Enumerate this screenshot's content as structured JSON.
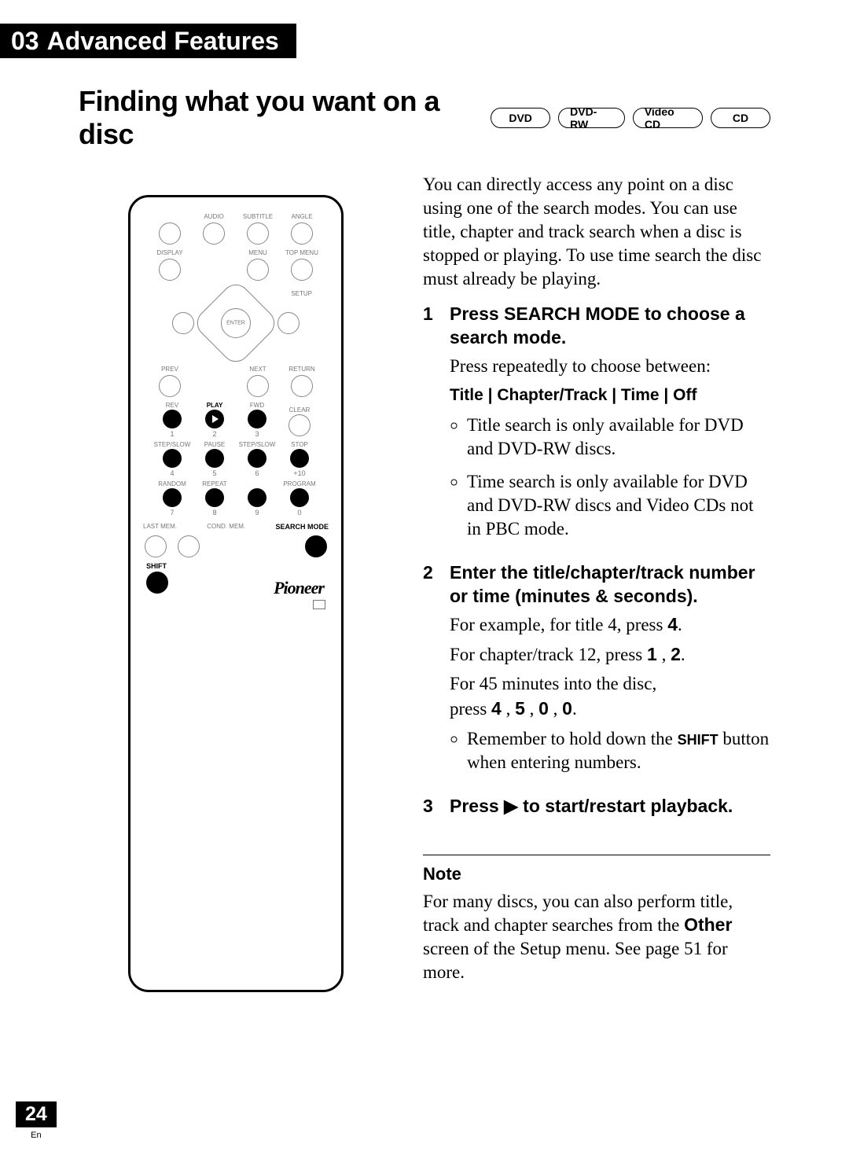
{
  "header": {
    "chapter_num": "03",
    "chapter_title": "Advanced Features"
  },
  "section": {
    "title": "Finding what you want on a disc",
    "media": [
      "DVD",
      "DVD-RW",
      "Video CD",
      "CD"
    ]
  },
  "intro": "You can directly access any point on a disc using one of the search modes. You can use title, chapter and track search when a disc is stopped or playing. To use time search the disc must already be playing.",
  "steps": {
    "s1": {
      "num": "1",
      "head": "Press SEARCH MODE to choose a search mode.",
      "sub": "Press repeatedly to choose between:",
      "modes": "Title | Chapter/Track | Time | Off",
      "b1": "Title search is only available for DVD and DVD-RW discs.",
      "b2": "Time search is only available for DVD and DVD-RW discs and Video CDs not in PBC mode."
    },
    "s2": {
      "num": "2",
      "head": "Enter the title/chapter/track number or time (minutes & seconds).",
      "ex1_pre": "For example, for title 4, press ",
      "ex1_key": "4",
      "ex1_post": ".",
      "ex2_pre": "For chapter/track 12, press ",
      "ex2_k1": "1",
      "ex2_mid": " , ",
      "ex2_k2": "2",
      "ex2_post": ".",
      "ex3_l1": "For 45 minutes into the disc,",
      "ex3_pre": "press ",
      "ex3_k1": "4",
      "ex3_c1": " , ",
      "ex3_k2": "5",
      "ex3_c2": " , ",
      "ex3_k3": "0",
      "ex3_c3": " , ",
      "ex3_k4": "0",
      "ex3_post": ".",
      "b1_pre": "Remember to hold down the ",
      "b1_key": "SHIFT",
      "b1_post": " button when entering numbers."
    },
    "s3": {
      "num": "3",
      "head_pre": "Press ",
      "head_sym": "▶",
      "head_post": " to start/restart playback."
    }
  },
  "note": {
    "title": "Note",
    "pre": "For many discs, you can also perform title, track and chapter searches from the ",
    "bold": "Other",
    "post": " screen of the Setup menu. See page 51 for more."
  },
  "page": {
    "num": "24",
    "lang": "En"
  },
  "remote": {
    "r1": [
      "",
      "AUDIO",
      "SUBTITLE",
      "ANGLE"
    ],
    "r2": [
      "DISPLAY",
      "",
      "MENU",
      "TOP MENU"
    ],
    "enter": "ENTER",
    "setup": "SETUP",
    "prev": "PREV",
    "next": "NEXT",
    "return": "RETURN",
    "row_play": {
      "labels": [
        "REV",
        "PLAY",
        "FWD",
        "CLEAR"
      ],
      "digits": [
        "1",
        "2",
        "3",
        ""
      ]
    },
    "row_pause": {
      "labels": [
        "STEP/SLOW",
        "PAUSE",
        "STEP/SLOW",
        "STOP"
      ],
      "digits": [
        "4",
        "5",
        "6",
        "+10"
      ]
    },
    "row_rand": {
      "labels": [
        "RANDOM",
        "REPEAT",
        "",
        "PROGRAM"
      ],
      "digits": [
        "7",
        "8",
        "9",
        "0"
      ]
    },
    "memrow": {
      "left1": "LAST MEM.",
      "left2": "COND. MEM.",
      "right": "SEARCH MODE"
    },
    "shift": "SHIFT",
    "brand": "Pioneer"
  }
}
